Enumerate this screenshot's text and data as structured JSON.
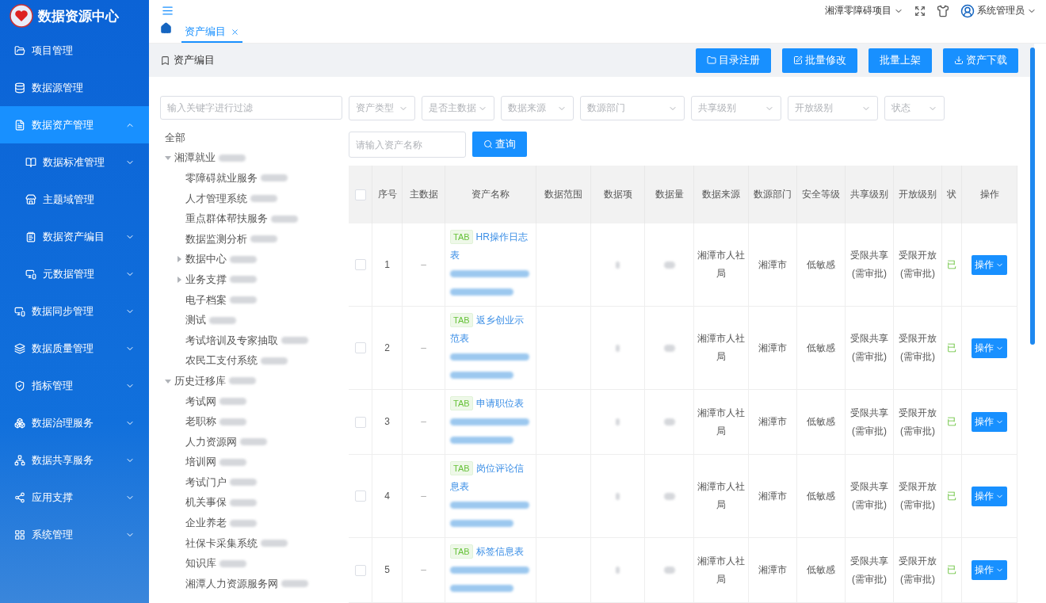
{
  "app": {
    "title": "数据资源中心"
  },
  "sidebar": {
    "items": [
      {
        "label": "项目管理",
        "selected": false
      },
      {
        "label": "数据源管理",
        "selected": false
      },
      {
        "label": "数据资产管理",
        "selected": true,
        "expanded": true,
        "children": [
          {
            "label": "数据标准管理",
            "selected": false,
            "expanded": false
          },
          {
            "label": "主题域管理",
            "selected": false
          },
          {
            "label": "数据资产编目",
            "selected": false,
            "expanded": false
          },
          {
            "label": "元数据管理",
            "selected": false,
            "expanded": false
          }
        ]
      },
      {
        "label": "数据同步管理",
        "selected": false,
        "expanded": false
      },
      {
        "label": "数据质量管理",
        "selected": false,
        "expanded": false
      },
      {
        "label": "指标管理",
        "selected": false,
        "expanded": false
      },
      {
        "label": "数据治理服务",
        "selected": false,
        "expanded": false
      },
      {
        "label": "数据共享服务",
        "selected": false,
        "expanded": false
      },
      {
        "label": "应用支撑",
        "selected": false,
        "expanded": false
      },
      {
        "label": "系统管理",
        "selected": false,
        "expanded": false
      }
    ]
  },
  "header": {
    "project": "湘潭零障碍项目",
    "user": "系统管理员"
  },
  "tabs": [
    {
      "label": "资产编目",
      "selected": true
    }
  ],
  "breadcrumb": "资产编目",
  "actions": [
    "目录注册",
    "批量修改",
    "批量上架",
    "资产下载"
  ],
  "tree": {
    "placeholder": "输入关键字进行过滤",
    "nodes": [
      {
        "label": "全部",
        "redacted": false
      },
      {
        "label": "湘潭就业",
        "redacted": true,
        "expanded": true,
        "children": [
          {
            "label": "零障碍就业服务",
            "redacted": true
          },
          {
            "label": "人才管理系统",
            "redacted": true
          },
          {
            "label": "重点群体帮扶服务",
            "redacted": true
          },
          {
            "label": "数据监测分析",
            "redacted": true
          },
          {
            "label": "数据中心",
            "redacted": true,
            "expanded": false
          },
          {
            "label": "业务支撑",
            "redacted": true,
            "expanded": false
          },
          {
            "label": "电子档案",
            "redacted": true
          },
          {
            "label": "测试",
            "redacted": true
          },
          {
            "label": "考试培训及专家抽取",
            "redacted": true
          },
          {
            "label": "农民工支付系统",
            "redacted": true
          }
        ]
      },
      {
        "label": "历史迁移库",
        "redacted": true,
        "expanded": true,
        "children": [
          {
            "label": "考试网",
            "redacted": true
          },
          {
            "label": "老职称",
            "redacted": true
          },
          {
            "label": "人力资源网",
            "redacted": true
          },
          {
            "label": "培训网",
            "redacted": true
          },
          {
            "label": "考试门户",
            "redacted": true
          },
          {
            "label": "机关事保",
            "redacted": true
          },
          {
            "label": "企业养老",
            "redacted": true
          },
          {
            "label": "社保卡采集系统",
            "redacted": true
          },
          {
            "label": "知识库",
            "redacted": true
          },
          {
            "label": "湘潭人力资源服务网",
            "redacted": true
          }
        ]
      }
    ]
  },
  "filters": [
    {
      "placeholder": "资产类型"
    },
    {
      "placeholder": "是否主数据"
    },
    {
      "placeholder": "数据来源"
    },
    {
      "placeholder": "数源部门"
    },
    {
      "placeholder": "共享级别"
    },
    {
      "placeholder": "开放级别"
    },
    {
      "placeholder": "状态"
    }
  ],
  "name_search": {
    "placeholder": "请输入资产名称",
    "button": "查询"
  },
  "table": {
    "header_checked": false,
    "columns": [
      "序号",
      "主数据",
      "资产名称",
      "数据范围",
      "数据项",
      "数据量",
      "数据来源",
      "数源部门",
      "安全等级",
      "共享级别",
      "开放级别",
      "状",
      "操作"
    ],
    "rows": [
      {
        "checked": false,
        "index": "1",
        "master": "–",
        "tag": "TAB",
        "name": "HR操作日志表",
        "source": "湘潭市人社局",
        "dept": "湘潭市",
        "security": "低敏感",
        "share": "受限共享(需审批)",
        "open": "受限开放(需审批)",
        "status": "已",
        "action": "操作"
      },
      {
        "checked": false,
        "index": "2",
        "master": "–",
        "tag": "TAB",
        "name": "返乡创业示范表",
        "source": "湘潭市人社局",
        "dept": "湘潭市",
        "security": "低敏感",
        "share": "受限共享(需审批)",
        "open": "受限开放(需审批)",
        "status": "已",
        "action": "操作"
      },
      {
        "checked": false,
        "index": "3",
        "master": "–",
        "tag": "TAB",
        "name": "申请职位表",
        "source": "湘潭市人社局",
        "dept": "湘潭市",
        "security": "低敏感",
        "share": "受限共享(需审批)",
        "open": "受限开放(需审批)",
        "status": "已",
        "action": "操作"
      },
      {
        "checked": false,
        "index": "4",
        "master": "–",
        "tag": "TAB",
        "name": "岗位评论信息表",
        "source": "湘潭市人社局",
        "dept": "湘潭市",
        "security": "低敏感",
        "share": "受限共享(需审批)",
        "open": "受限开放(需审批)",
        "status": "已",
        "action": "操作"
      },
      {
        "checked": false,
        "index": "5",
        "master": "–",
        "tag": "TAB",
        "name": "标签信息表",
        "source": "湘潭市人社局",
        "dept": "湘潭市",
        "security": "低敏感",
        "share": "受限共享(需审批)",
        "open": "受限开放(需审批)",
        "status": "已",
        "action": "操作"
      }
    ]
  }
}
